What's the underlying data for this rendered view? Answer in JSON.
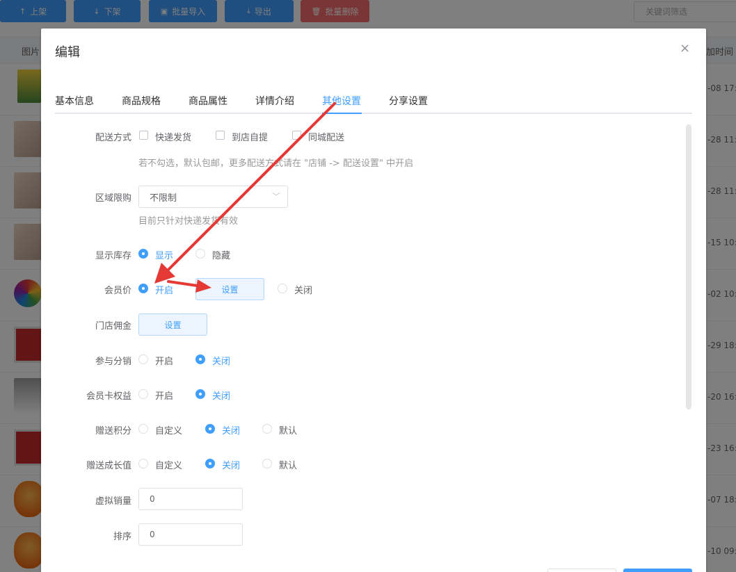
{
  "toolbar": {
    "buttons": [
      {
        "label": "上架",
        "icon": "arrow-up-icon",
        "color": "#409eff"
      },
      {
        "label": "下架",
        "icon": "arrow-down-icon",
        "color": "#409eff"
      },
      {
        "label": "批量导入",
        "icon": "file-import-icon",
        "color": "#409eff"
      },
      {
        "label": "导出",
        "icon": "download-icon",
        "color": "#409eff"
      },
      {
        "label": "批量删除",
        "icon": "trash-icon",
        "color": "#f56c6c"
      }
    ],
    "search_placeholder": "关键词筛选"
  },
  "table": {
    "header_image": "图片",
    "header_time": "加时间",
    "rows": [
      {
        "time": "-08 17:"
      },
      {
        "time": "-28 11:"
      },
      {
        "time": "-28 11:"
      },
      {
        "time": "-15 10:"
      },
      {
        "time": "-02 10:"
      },
      {
        "time": "-29 18:"
      },
      {
        "time": "-20 16:"
      },
      {
        "time": "-23 16:"
      },
      {
        "time": "-07 18:"
      },
      {
        "time": "-10 09:"
      }
    ]
  },
  "dialog": {
    "title": "编辑",
    "close_symbol": "×",
    "tabs": [
      "基本信息",
      "商品规格",
      "商品属性",
      "详情介绍",
      "其他设置",
      "分享设置"
    ],
    "active_tab": "其他设置",
    "form": {
      "delivery": {
        "label": "配送方式",
        "options": [
          "快递发货",
          "到店自提",
          "同城配送"
        ],
        "hint": "若不勾选，默认包邮，更多配送方式请在 \"店铺 -> 配送设置\" 中开启"
      },
      "region": {
        "label": "区域限购",
        "value": "不限制",
        "hint": "目前只针对快递发货有效"
      },
      "stock": {
        "label": "显示库存",
        "options": [
          "显示",
          "隐藏"
        ],
        "selected": "显示"
      },
      "member_price": {
        "label": "会员价",
        "on": "开启",
        "set": "设置",
        "off": "关闭",
        "selected": "开启"
      },
      "store_commission": {
        "label": "门店佣金",
        "set": "设置"
      },
      "distribution": {
        "label": "参与分销",
        "options": [
          "开启",
          "关闭"
        ],
        "selected": "关闭"
      },
      "member_card": {
        "label": "会员卡权益",
        "options": [
          "开启",
          "关闭"
        ],
        "selected": "关闭"
      },
      "points": {
        "label": "赠送积分",
        "options": [
          "自定义",
          "关闭",
          "默认"
        ],
        "selected": "关闭"
      },
      "growth": {
        "label": "赠送成长值",
        "options": [
          "自定义",
          "关闭",
          "默认"
        ],
        "selected": "关闭"
      },
      "virtual_sales": {
        "label": "虚拟销量",
        "value": "0"
      },
      "sort": {
        "label": "排序",
        "value": "0"
      }
    }
  },
  "annotation": {
    "arrow_color": "#e53935"
  }
}
